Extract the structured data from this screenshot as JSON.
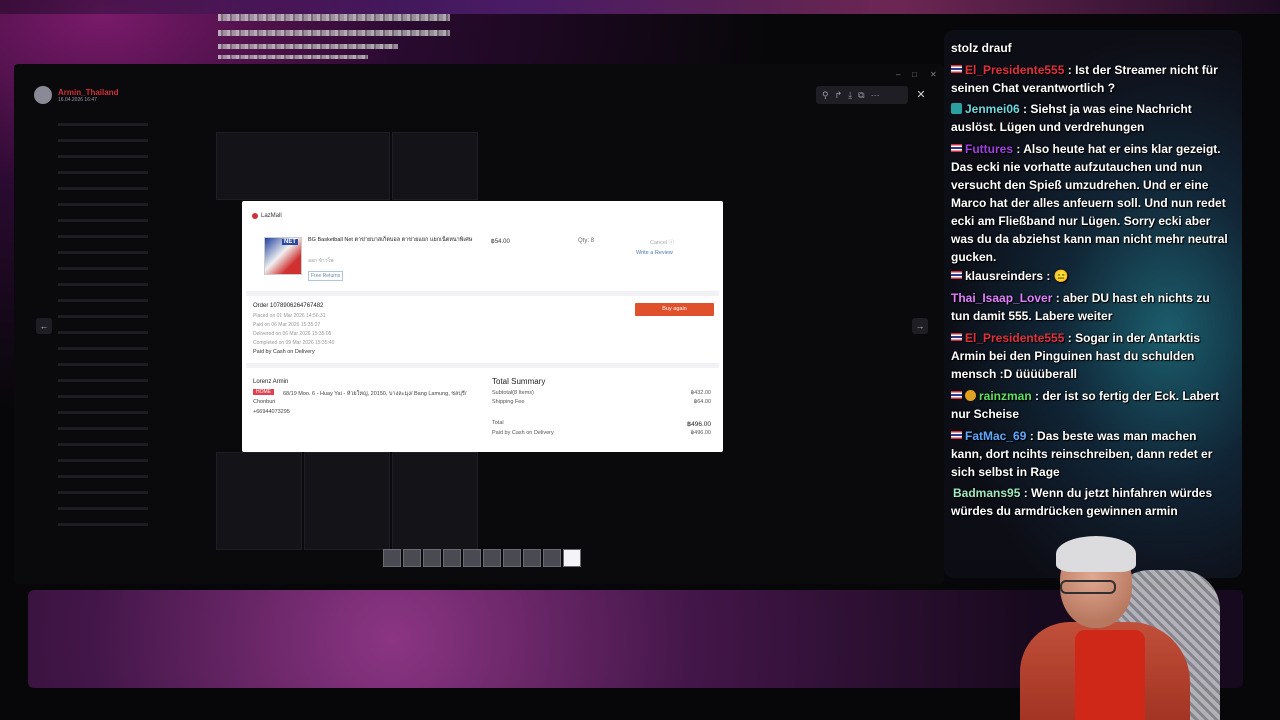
{
  "discord": {
    "username": "Armin_Thailand",
    "date": "16.04.2026 16:47"
  },
  "viewer": {
    "tools": [
      "zoom-icon",
      "forward-icon",
      "download-icon",
      "open-icon",
      "more-icon"
    ],
    "close": "✕",
    "prev_arrow": "←",
    "next_arrow": "→"
  },
  "order": {
    "shop": "LazMall",
    "product_title": "BG Basketball Net ตาข่ายบาสเก็ตบอล ตาข่ายแยก แยกเน็ตหนาพิเศษ",
    "product_variant": "ลอก ข้าวโพ",
    "badge_net": "NET",
    "free_returns": "Free Returns",
    "price": "฿54.00",
    "qty": "Qty: 8",
    "cancel": "Cancel ⓘ",
    "write_review": "Write a Review",
    "order_no": "Order 1078906264767482",
    "placed": "Placed on 01 Mar 2026 14:56:31",
    "paid": "Paid on 06 Mar 2026 15:35:27",
    "delivered": "Delivered on 06 Mar 2026 15:35:05",
    "completed": "Completed on 09 Mar 2026 15:35:40",
    "paid_by": "Paid by Cash on Delivery",
    "buy_again": "Buy again",
    "recipient": "Lorenz Armin",
    "home_tag": "HOME",
    "address": "68/19 Moo. 6 - Huay Yai - ห้วยใหญ่, 20150, บางละมุง/ Bang Lamung, ชลบุรี/ Chonburi",
    "phone": "+66944073295",
    "summary_title": "Total Summary",
    "subtotal_label": "Subtotal(8 Items)",
    "subtotal_value": "฿432.00",
    "shipping_label": "Shipping Fee",
    "shipping_value": "฿64.00",
    "total_label": "Total",
    "total_value": "฿496.00",
    "paid_cod_label": "Paid by Cash on Delivery",
    "paid_cod_value": "฿496.00"
  },
  "chat": {
    "messages": [
      {
        "user": "",
        "text": "stolz drauf"
      },
      {
        "user": "El_Presidente555",
        "text": " : Ist der Streamer nicht für seinen Chat verantwortlich ?"
      },
      {
        "user": "Jenmei06",
        "text": " : Siehst ja was eine Nachricht auslöst. Lügen und verdrehungen"
      },
      {
        "user": "Futtures",
        "text": " : Also heute hat er eins klar gezeigt. Das ecki nie vorhatte aufzutauchen und nun versucht den Spieß umzudrehen. Und er eine Marco hat der alles anfeuern soll. Und nun redet ecki am Fließband nur Lügen. Sorry ecki aber was du da abziehst kann man nicht mehr neutral gucken."
      },
      {
        "user": "klausreinders",
        "text": " : 😑"
      },
      {
        "user": "Thai_Isaap_Lover",
        "text": " : aber DU hast eh nichts zu tun damit 555. Labere weiter"
      },
      {
        "user": "El_Presidente555",
        "text": " : Sogar in der Antarktis Armin bei den Pinguinen hast du schulden mensch :D üüüüberall"
      },
      {
        "user": "rainzman",
        "text": " : der ist so fertig der Eck. Labert nur Scheise"
      },
      {
        "user": "FatMac_69",
        "text": " : Das beste was man machen kann, dort ncihts reinschreiben, dann redet er sich selbst in Rage"
      },
      {
        "user": "Badmans95",
        "text": " : Wenn du jetzt hinfahren würdes würdes du armdrücken gewinnen armin"
      }
    ]
  },
  "colors": {
    "accent_buy": "#e0502a",
    "user_red": "#e0303a",
    "user_teal": "#6ad8e0",
    "user_purple": "#a040e0",
    "user_pink": "#e080ff",
    "user_green": "#60e060",
    "user_blue": "#60a8ff",
    "user_mint": "#a0e8c0"
  }
}
